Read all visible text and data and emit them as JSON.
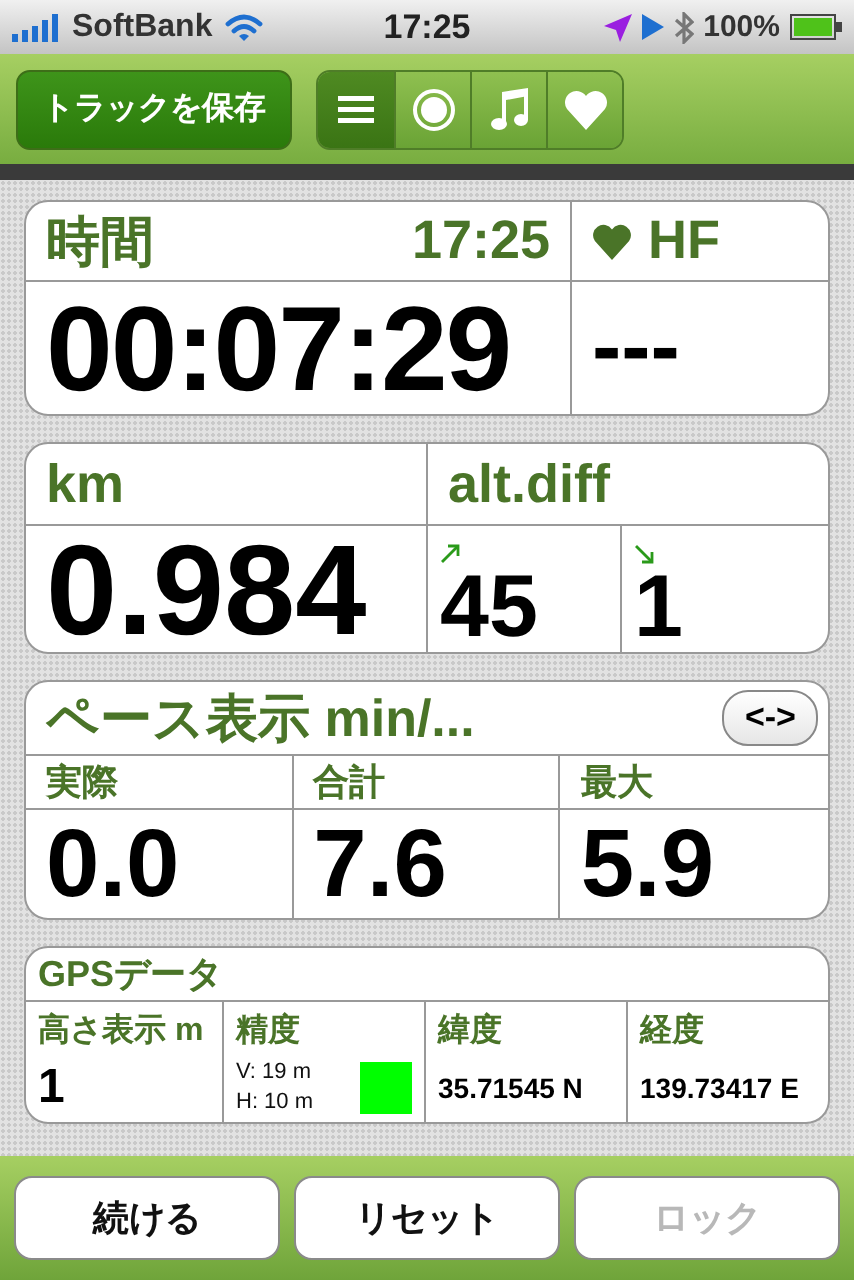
{
  "status_bar": {
    "carrier": "SoftBank",
    "time": "17:25",
    "battery": "100%"
  },
  "toolbar": {
    "save_button": "トラックを保存",
    "segments": [
      {
        "kind": "list",
        "selected": true
      },
      {
        "kind": "record",
        "selected": false
      },
      {
        "kind": "music",
        "selected": false
      },
      {
        "kind": "heart",
        "selected": false
      }
    ]
  },
  "time_card": {
    "label": "時間",
    "clock": "17:25",
    "value": "00:07:29",
    "heart_rate_label": "HF",
    "heart_rate_value": "---"
  },
  "distance_card": {
    "label": "km",
    "value": "0.984",
    "altitude_label": "alt.diff",
    "ascent": "45",
    "descent": "1"
  },
  "pace_card": {
    "title": "ペース表示 min/...",
    "toggle": "<->",
    "columns": [
      {
        "label": "実際",
        "value": "0.0"
      },
      {
        "label": "合計",
        "value": "7.6"
      },
      {
        "label": "最大",
        "value": "5.9"
      }
    ]
  },
  "gps_card": {
    "title": "GPSデータ",
    "altitude": {
      "label": "高さ表示 m",
      "value": "1"
    },
    "accuracy": {
      "label": "精度",
      "vertical": "V: 19 m",
      "horizontal": "H: 10 m",
      "color": "#00ff00"
    },
    "latitude": {
      "label": "緯度",
      "value": "35.71545 N"
    },
    "longitude": {
      "label": "経度",
      "value": "139.73417 E"
    }
  },
  "buttons": [
    {
      "label": "続ける",
      "disabled": false
    },
    {
      "label": "リセット",
      "disabled": false
    },
    {
      "label": "ロック",
      "disabled": true
    }
  ]
}
